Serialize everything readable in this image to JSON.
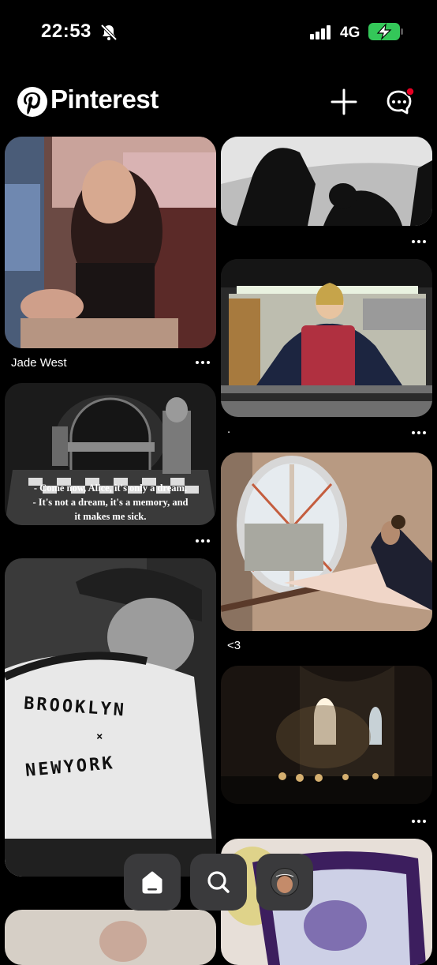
{
  "status_bar": {
    "time": "22:53",
    "network": "4G"
  },
  "header": {
    "brand": "Pinterest"
  },
  "pins": {
    "jade": {
      "caption": "Jade West"
    },
    "kitchen": {
      "caption": "."
    },
    "alice": {
      "line1": "- Come now, Alice, it's only a dream.",
      "line2": "- It's not a dream, it's a memory, and",
      "line3": "it makes me sick."
    },
    "ballet": {
      "caption": "<3"
    },
    "brooklyn": {
      "line1": "BROOKLYN",
      "line2": "×",
      "line3": "NEWYORK"
    }
  },
  "colors": {
    "background": "#000000",
    "nav_button": "#3a3a3c",
    "notification_dot": "#e60023",
    "battery": "#34c759"
  }
}
